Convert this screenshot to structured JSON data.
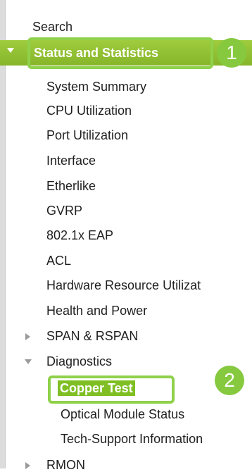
{
  "nav": {
    "search_label": "Search",
    "status_section": {
      "label": "Status and Statistics",
      "callout": "1",
      "items": [
        "System Summary",
        "CPU Utilization",
        "Port Utilization",
        "Interface",
        "Etherlike",
        "GVRP",
        "802.1x EAP",
        "ACL",
        "Hardware Resource Utilizat",
        "Health and Power"
      ]
    },
    "span_label": "SPAN & RSPAN",
    "diagnostics": {
      "label": "Diagnostics",
      "callout": "2",
      "items": [
        "Copper Test",
        "Optical Module Status",
        "Tech-Support Information"
      ]
    },
    "rmon_label": "RMON"
  },
  "colors": {
    "section_header": "#86b52a",
    "callout": "#8fd14b",
    "highlight": "#7fbf23"
  },
  "icons": {
    "expanded": "chevron-down-icon",
    "collapsed": "chevron-right-icon"
  }
}
